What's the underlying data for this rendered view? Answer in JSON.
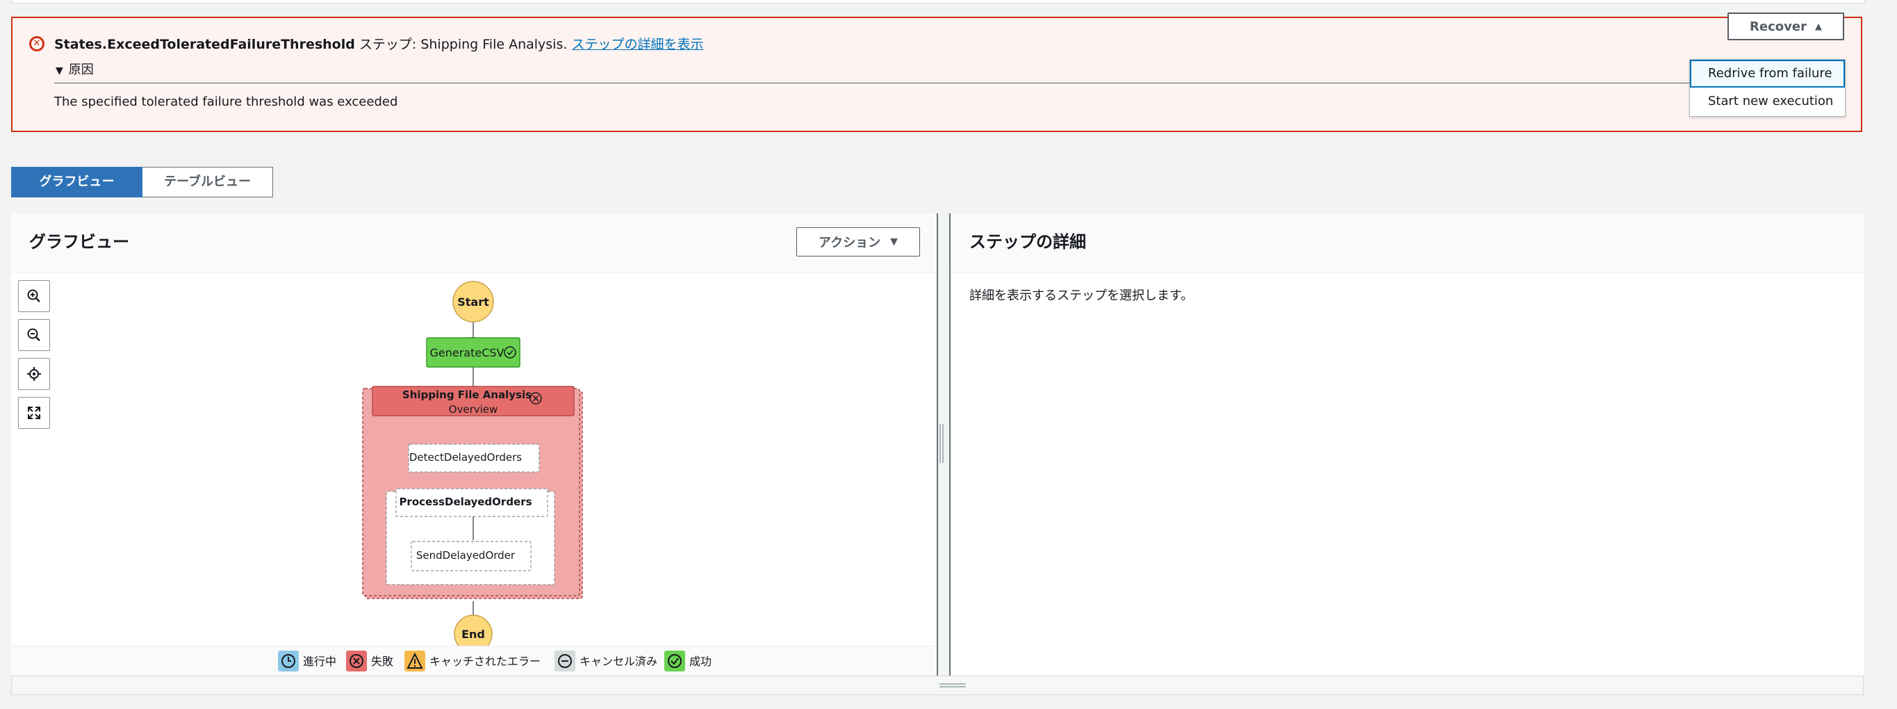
{
  "alert": {
    "error_code": "States.ExceedToleratedFailureThreshold",
    "step_prefix": " ステップ: Shipping File Analysis. ",
    "details_link": "ステップの詳細を表示",
    "cause_label": "原因",
    "cause_text": "The specified tolerated failure threshold was exceeded"
  },
  "recover": {
    "label": "Recover",
    "menu": [
      "Redrive from failure",
      "Start new execution"
    ]
  },
  "view_tabs": {
    "graph": "グラフビュー",
    "table": "テーブルビュー"
  },
  "graph_panel": {
    "title": "グラフビュー",
    "action_label": "アクション",
    "nodes": {
      "start": "Start",
      "generate_csv": "GenerateCSV",
      "map_title": "Shipping File Analysis",
      "map_subtitle": "Overview",
      "detect": "DetectDelayedOrders",
      "process": "ProcessDelayedOrders",
      "send": "SendDelayedOrder",
      "end": "End"
    },
    "legend": {
      "in_progress": "進行中",
      "failed": "失敗",
      "caught_error": "キャッチされたエラー",
      "cancelled": "キャンセル済み",
      "succeeded": "成功"
    }
  },
  "detail_panel": {
    "title": "ステップの詳細",
    "hint": "詳細を表示するステップを選択します。"
  },
  "colors": {
    "error": "#d13212",
    "success_node": "#69d14f",
    "failed_node": "#e46d6b",
    "failed_map_bg": "#f0a9a8",
    "start_end_node": "#fdd97c",
    "primary": "#2e73b8"
  }
}
